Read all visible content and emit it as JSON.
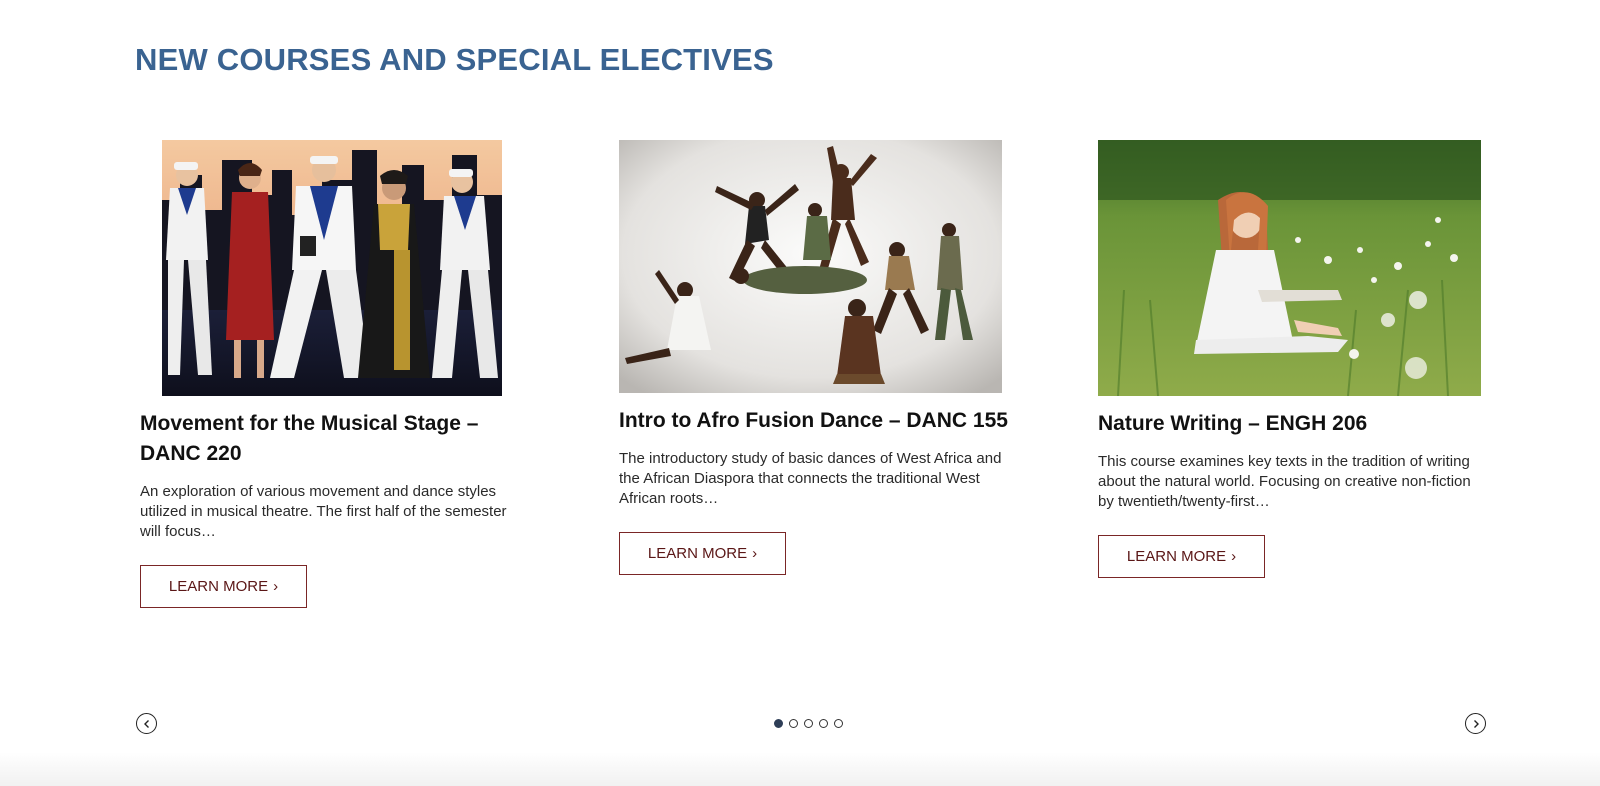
{
  "section": {
    "heading": "NEW COURSES AND SPECIAL ELECTIVES"
  },
  "cards": [
    {
      "title": "Movement for the Musical Stage – DANC 220",
      "description": "An exploration of various movement and dance styles utilized in musical theatre. The first half of the semester will focus…",
      "button_label": "LEARN MORE",
      "button_icon": "chevron-right-icon",
      "image_alt": "Performers in sailor costumes dancing on stage"
    },
    {
      "title": "Intro to Afro Fusion Dance – DANC 155",
      "description": "The introductory study of basic dances of West Africa and the African Diaspora that connects the traditional West African roots…",
      "button_label": "LEARN MORE",
      "button_icon": "chevron-right-icon",
      "image_alt": "Group of dancers leaping mid-air"
    },
    {
      "title": "Nature Writing – ENGH 206",
      "description": "This course examines key texts in the tradition of writing about the natural world. Focusing on creative non-fiction by twentieth/twenty-first…",
      "button_label": "LEARN MORE",
      "button_icon": "chevron-right-icon",
      "image_alt": "Woman writing in a notebook in a grassy field"
    }
  ],
  "carousel": {
    "prev_icon": "chevron-left-icon",
    "next_icon": "chevron-right-icon",
    "page_count": 5,
    "active_page": 1
  },
  "colors": {
    "heading": "#3a6391",
    "button_border": "#7a2626",
    "button_text": "#5a1616",
    "dot_active": "#2e3e57"
  }
}
